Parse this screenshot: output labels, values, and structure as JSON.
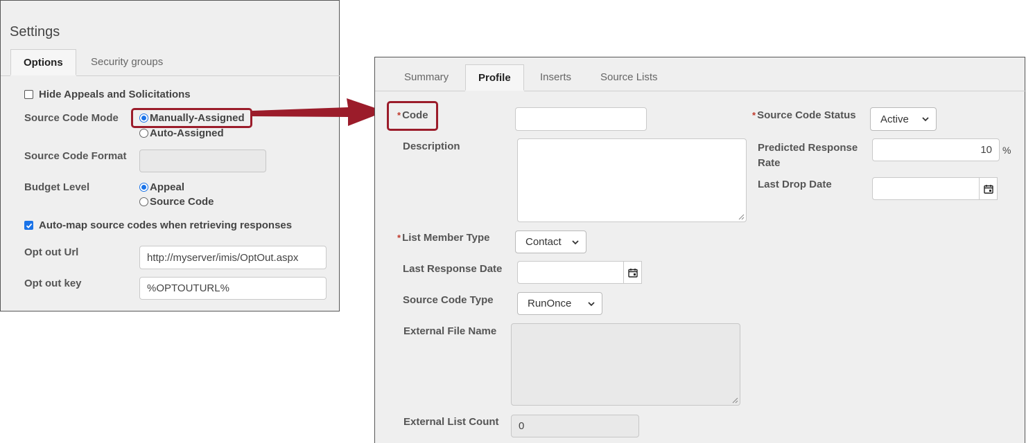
{
  "settings": {
    "title": "Settings",
    "tabs": [
      {
        "label": "Options",
        "active": true
      },
      {
        "label": "Security groups",
        "active": false
      }
    ],
    "hide_appeals_label": "Hide Appeals and Solicitations",
    "hide_appeals_checked": false,
    "source_code_mode_label": "Source Code Mode",
    "source_code_mode_options": [
      "Manually-Assigned",
      "Auto-Assigned"
    ],
    "source_code_mode_selected": "Manually-Assigned",
    "source_code_format_label": "Source Code Format",
    "source_code_format_value": "",
    "budget_level_label": "Budget Level",
    "budget_level_options": [
      "Appeal",
      "Source Code"
    ],
    "budget_level_selected": "Appeal",
    "automap_label": "Auto-map source codes when retrieving responses",
    "automap_checked": true,
    "opt_out_url_label": "Opt out Url",
    "opt_out_url_value": "http://myserver/imis/OptOut.aspx",
    "opt_out_key_label": "Opt out key",
    "opt_out_key_value": "%OPTOUTURL%"
  },
  "profile": {
    "tabs": [
      {
        "label": "Summary",
        "active": false
      },
      {
        "label": "Profile",
        "active": true
      },
      {
        "label": "Inserts",
        "active": false
      },
      {
        "label": "Source Lists",
        "active": false
      }
    ],
    "required_marker": "*",
    "code_label": "Code",
    "code_value": "",
    "description_label": "Description",
    "description_value": "",
    "list_member_type_label": "List Member Type",
    "list_member_type_value": "Contact",
    "last_response_date_label": "Last Response Date",
    "last_response_date_value": "",
    "source_code_type_label": "Source Code Type",
    "source_code_type_value": "RunOnce",
    "external_file_name_label": "External File Name",
    "external_list_count_label": "External List Count",
    "external_list_count_value": "0",
    "source_code_status_label": "Source Code Status",
    "source_code_status_value": "Active",
    "predicted_response_rate_label_line1": "Predicted Response",
    "predicted_response_rate_label_line2": "Rate",
    "predicted_response_rate_value": "10",
    "percent_symbol": "%",
    "last_drop_date_label": "Last Drop Date",
    "last_drop_date_value": ""
  },
  "colors": {
    "highlight": "#9b1c2a",
    "accent": "#1a73e8",
    "required": "#c0392b",
    "panel_bg": "#efefef"
  }
}
